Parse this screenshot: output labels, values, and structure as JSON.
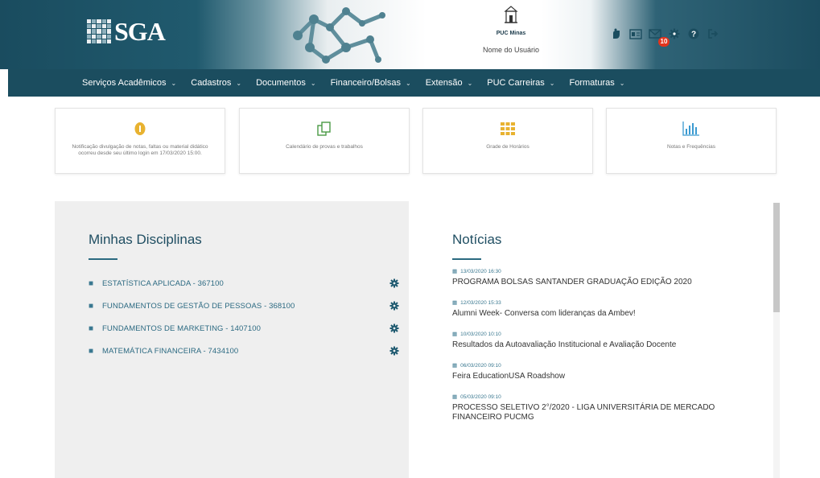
{
  "header": {
    "logo_text": "SGA",
    "university": "PUC Minas",
    "user_name": "Nome do Usuário",
    "notification_count": "10",
    "icons": [
      "accessibility-icon",
      "card-icon",
      "mail-icon",
      "gear-icon",
      "help-icon",
      "logout-icon"
    ]
  },
  "nav": {
    "items": [
      {
        "label": "Serviços Acadêmicos"
      },
      {
        "label": "Cadastros"
      },
      {
        "label": "Documentos"
      },
      {
        "label": "Financeiro/Bolsas"
      },
      {
        "label": "Extensão"
      },
      {
        "label": "PUC Carreiras"
      },
      {
        "label": "Formaturas"
      }
    ]
  },
  "cards": [
    {
      "label": "Notificação divulgação de notas, faltas ou material didático ocorreu desde seu último login em 17/03/2020 15:00.",
      "icon": "info-icon"
    },
    {
      "label": "Calendário de provas e trabalhos",
      "icon": "copy-icon"
    },
    {
      "label": "Grade de Horários",
      "icon": "grid-icon"
    },
    {
      "label": "Notas e Frequências",
      "icon": "bar-chart-icon"
    }
  ],
  "disciplinas": {
    "title": "Minhas Disciplinas",
    "items": [
      {
        "label": "ESTATÍSTICA APLICADA - 367100"
      },
      {
        "label": "FUNDAMENTOS DE GESTÃO DE PESSOAS - 368100"
      },
      {
        "label": "FUNDAMENTOS DE MARKETING - 1407100"
      },
      {
        "label": "MATEMÁTICA FINANCEIRA - 7434100"
      }
    ]
  },
  "noticias": {
    "title": "Notícias",
    "items": [
      {
        "date": "13/03/2020 16:30",
        "title": "PROGRAMA BOLSAS SANTANDER GRADUAÇÃO EDIÇÃO 2020"
      },
      {
        "date": "12/03/2020 15:33",
        "title": "Alumni Week- Conversa com lideranças da Ambev!"
      },
      {
        "date": "10/03/2020 10:10",
        "title": "Resultados da Autoavaliação Institucional e Avaliação Docente"
      },
      {
        "date": "06/03/2020 09:10",
        "title": "Feira EducationUSA Roadshow"
      },
      {
        "date": "05/03/2020 09:10",
        "title": "PROCESSO SELETIVO 2°/2020 - LIGA UNIVERSITÁRIA DE MERCADO FINANCEIRO PUCMG"
      }
    ]
  },
  "colors": {
    "primary": "#1b4d5f",
    "accent": "#2c6a82",
    "badge": "#e2341d",
    "card_icon": "#e8b230",
    "green_icon": "#4a9a45"
  }
}
